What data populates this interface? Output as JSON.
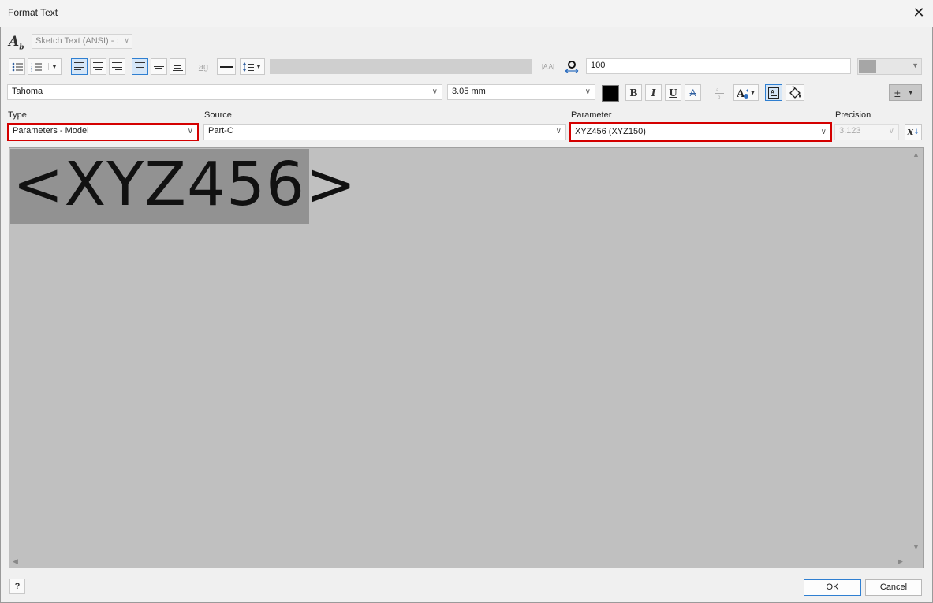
{
  "window": {
    "title": "Format Text",
    "close_glyph": "✕"
  },
  "style": {
    "value": "Sketch Text (ANSI) - :"
  },
  "toolbar": {
    "stacking_label": "ag",
    "width_value": "100",
    "spacing_icon": "|A A|"
  },
  "font": {
    "family": "Tahoma",
    "size": "3.05 mm",
    "color": "#000000",
    "bold_label": "B",
    "italic_label": "I",
    "underline_label": "U",
    "strike_label": "A",
    "symbol_label": "±"
  },
  "parameters": {
    "type_label": "Type",
    "type_value": "Parameters - Model",
    "source_label": "Source",
    "source_value": "Part-C",
    "parameter_label": "Parameter",
    "parameter_value": "XYZ456 (XYZ150)",
    "precision_label": "Precision",
    "precision_value": "3.123",
    "insert_label": "x"
  },
  "editor": {
    "text": "<XYZ456>"
  },
  "footer": {
    "ok_label": "OK",
    "cancel_label": "Cancel",
    "help_label": "?"
  },
  "colors": {
    "highlight_border": "#d40000",
    "accent": "#2f7fd1"
  }
}
